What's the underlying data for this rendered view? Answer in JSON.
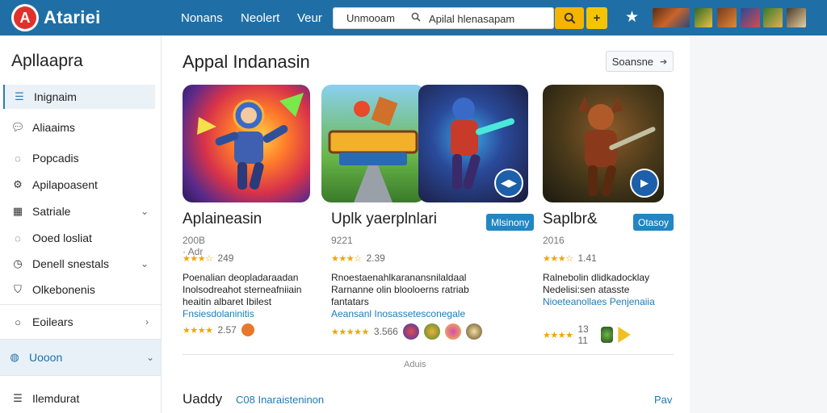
{
  "header": {
    "logo_letter": "A",
    "brand": "Atariei",
    "nav": [
      "Nonans",
      "Neolert",
      "Veur"
    ],
    "search": {
      "scope": "Unmooam",
      "value": "Apilal hlenasapam",
      "search_icon": "search-icon",
      "plus_icon": "plus-icon"
    },
    "star_icon": "star-icon"
  },
  "sidebar": {
    "title": "Apllaapra",
    "items": [
      {
        "label": "Inignaim",
        "icon": "list-icon",
        "active": true
      },
      {
        "label": "Aliaaims",
        "icon": "chat-icon"
      },
      {
        "label": "Popcadis",
        "icon": "chat-icon"
      },
      {
        "label": "Apilapoasent",
        "icon": "gear-icon"
      },
      {
        "label": "Satriale",
        "icon": "grid-icon",
        "chevron": "⌄"
      },
      {
        "label": "Ooed losliat",
        "icon": "chat-icon"
      },
      {
        "label": "Denell snestals",
        "icon": "clock-icon",
        "chevron": "⌄"
      },
      {
        "label": "Olkebonenis",
        "icon": "shield-icon"
      },
      {
        "label": "Eoilears",
        "icon": "circle-icon",
        "chevron": "›"
      },
      {
        "label": "Uooon",
        "icon": "globe-icon",
        "chevron": "⌄"
      },
      {
        "label": "Ilemdurat",
        "icon": "list-icon"
      }
    ]
  },
  "main": {
    "title": "Appal Indanasin",
    "more_button": "Soansne",
    "more_arrow": "➔",
    "cards": [
      {
        "name": "Aplaineasin",
        "badge": "",
        "meta": "200B · Adr",
        "rating_stars": "★★★☆",
        "rating_value": "249",
        "desc": "Poenalian deopladaraadan Inolsodreahot sterneafniiain heaitin albaret Ibilest",
        "desc_link": "Fnsiesdolaninitis",
        "foot_stars": "★★★★",
        "foot_value": "2.57"
      },
      {
        "name": "Uplk yaerplnlari",
        "badge": "Mlsinony",
        "meta": "9221",
        "rating_stars": "★★★☆",
        "rating_value": "2.39",
        "desc": "Rnoestaenahlkaranansnilaldaal Rarnanne olin blooloerns ratriab fantatars",
        "desc_link": "Aeansanl Inosassetesconegale",
        "foot_stars": "★★★★★",
        "foot_value": "3.566"
      },
      {
        "name": "Saplbr&",
        "badge": "Otasoy",
        "meta": "2016",
        "rating_stars": "★★★☆",
        "rating_value": "1.41",
        "desc": "Ralnebolin dlidkadocklay Nedelisi:sen atasste",
        "desc_link": "Nioeteanollaes Penjenaiia",
        "foot_stars": "★★★★",
        "foot_value": "13 11"
      }
    ],
    "divider_label": "Aduis",
    "bottom_title": "Uaddy",
    "bottom_link": "C08 Inaraisteninon",
    "bottom_right": "Pav"
  },
  "colors": {
    "topbar": "#1f6fa6",
    "accent": "#2286c3",
    "search_button": "#f5b400",
    "star": "#f0a500"
  }
}
